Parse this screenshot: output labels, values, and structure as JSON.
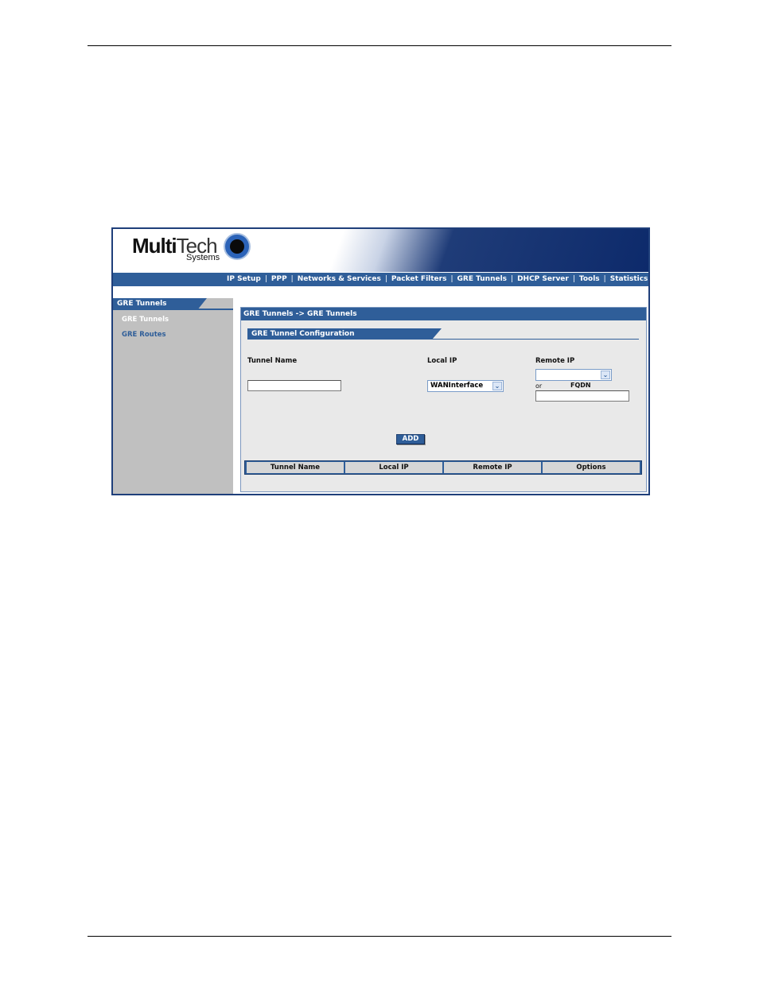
{
  "brand": {
    "logo_bold": "Multi",
    "logo_light": "Tech",
    "logo_sub": "Systems"
  },
  "nav": [
    "IP Setup",
    "PPP",
    "Networks & Services",
    "Packet Filters",
    "GRE Tunnels",
    "DHCP Server",
    "Tools",
    "Statistics &"
  ],
  "sidebar": {
    "title": "GRE Tunnels",
    "items": [
      {
        "label": "GRE Tunnels"
      },
      {
        "label": "GRE Routes"
      }
    ]
  },
  "content": {
    "breadcrumb": "GRE Tunnels  ->  GRE Tunnels",
    "section_title": "GRE Tunnel Configuration",
    "fields": {
      "tunnel_name_label": "Tunnel Name",
      "tunnel_name_value": "",
      "local_ip_label": "Local IP",
      "local_ip_selected": "WANInterface",
      "remote_ip_label": "Remote IP",
      "remote_ip_selected": "",
      "or_label": "or",
      "fqdn_label": "FQDN",
      "fqdn_value": ""
    },
    "add_button": "ADD",
    "table": {
      "columns": [
        "Tunnel Name",
        "Local IP",
        "Remote IP",
        "Options"
      ],
      "rows": []
    }
  },
  "colors": {
    "nav_blue": "#2f5e99",
    "sidebar_gray": "#c0c0c0",
    "panel_gray": "#e9e9e9"
  }
}
